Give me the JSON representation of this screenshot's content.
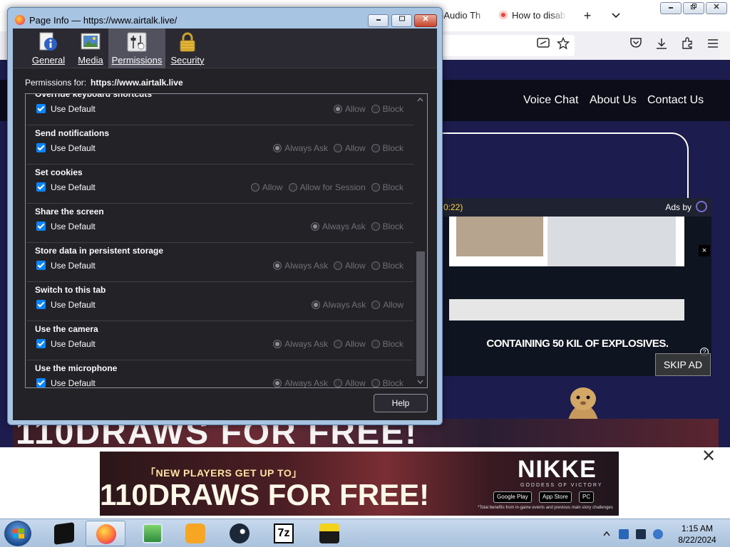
{
  "browser": {
    "tabs": [
      {
        "label": "-Audio Th"
      },
      {
        "label": "How to disab"
      }
    ],
    "new_tab_symbol": "+",
    "tab_list_symbol": "⌄",
    "window_controls": [
      "minimize-icon",
      "restore-icon",
      "close-icon"
    ],
    "nav_icons": [
      "screenshot-icon",
      "star-icon",
      "pocket-icon",
      "download-icon",
      "extensions-icon",
      "menu-icon"
    ]
  },
  "site": {
    "nav": [
      "Voice Chat",
      "About Us",
      "Contact Us"
    ]
  },
  "video_ad": {
    "timer": "0:22)",
    "ads_by": "Ads by",
    "close": "×",
    "caption": "CONTAINING 50 KIL      OF EXPLOSIVES.",
    "help": "?",
    "skip_label": "SKIP AD"
  },
  "banner_ad": {
    "headline_top": "NEW PLAYERS GET UP TO",
    "headline_big": "110 DRAWS FOR FREE!",
    "subline": "「NEW PLAYERS GET UP TO」",
    "big_line": "110DRAWS FOR FREE!",
    "logo": "NIKKE",
    "logo_sub": "GODDESS OF VICTORY",
    "stores": [
      "Google Play",
      "App Store",
      "PC"
    ],
    "note": "*Total benefits from in-game events and previous main story challenges",
    "close": "×",
    "info": "▷"
  },
  "bottom_close": "✕",
  "taskbar": {
    "apps": [
      "terminal-icon",
      "firefox-icon",
      "explorer-icon",
      "kangaroo-icon",
      "steam-icon",
      "7zip-icon",
      "floppy-icon"
    ],
    "clock_time": "1:15 AM",
    "clock_date": "8/22/2024"
  },
  "dialog": {
    "title": "Page Info — https://www.airtalk.live/",
    "controls": {
      "minimize": "‒",
      "restore": "▭",
      "close": "✕"
    },
    "tabs": [
      {
        "label": "General",
        "icon": "info-icon",
        "selected": false
      },
      {
        "label": "Media",
        "icon": "media-icon",
        "selected": false
      },
      {
        "label": "Permissions",
        "icon": "permissions-icon",
        "selected": true
      },
      {
        "label": "Security",
        "icon": "lock-icon",
        "selected": false
      }
    ],
    "permissions_for_label": "Permissions for:",
    "permissions_for_url": "https://www.airtalk.live",
    "use_default_label": "Use Default",
    "permissions": [
      {
        "title": "Override keyboard shortcuts",
        "options": [
          {
            "label": "Allow",
            "checked": true
          },
          {
            "label": "Block",
            "checked": false
          }
        ]
      },
      {
        "title": "Send notifications",
        "options": [
          {
            "label": "Always Ask",
            "checked": true
          },
          {
            "label": "Allow",
            "checked": false
          },
          {
            "label": "Block",
            "checked": false
          }
        ]
      },
      {
        "title": "Set cookies",
        "options": [
          {
            "label": "Allow",
            "checked": false
          },
          {
            "label": "Allow for Session",
            "checked": false
          },
          {
            "label": "Block",
            "checked": false
          }
        ]
      },
      {
        "title": "Share the screen",
        "options": [
          {
            "label": "Always Ask",
            "checked": true
          },
          {
            "label": "Block",
            "checked": false
          }
        ]
      },
      {
        "title": "Store data in persistent storage",
        "options": [
          {
            "label": "Always Ask",
            "checked": true
          },
          {
            "label": "Allow",
            "checked": false
          },
          {
            "label": "Block",
            "checked": false
          }
        ]
      },
      {
        "title": "Switch to this tab",
        "options": [
          {
            "label": "Always Ask",
            "checked": true
          },
          {
            "label": "Allow",
            "checked": false
          }
        ]
      },
      {
        "title": "Use the camera",
        "options": [
          {
            "label": "Always Ask",
            "checked": true
          },
          {
            "label": "Allow",
            "checked": false
          },
          {
            "label": "Block",
            "checked": false
          }
        ]
      },
      {
        "title": "Use the microphone",
        "options": [
          {
            "label": "Always Ask",
            "checked": true
          },
          {
            "label": "Allow",
            "checked": false
          },
          {
            "label": "Block",
            "checked": false
          }
        ]
      }
    ],
    "scroll_fraction": 0.55,
    "help_label": "Help"
  },
  "colors": {
    "dialog_bg": "#232327",
    "accent_checkbox": "#0a84ff",
    "site_bg": "#1d1c4f",
    "taskbar": "#b7cde6"
  }
}
